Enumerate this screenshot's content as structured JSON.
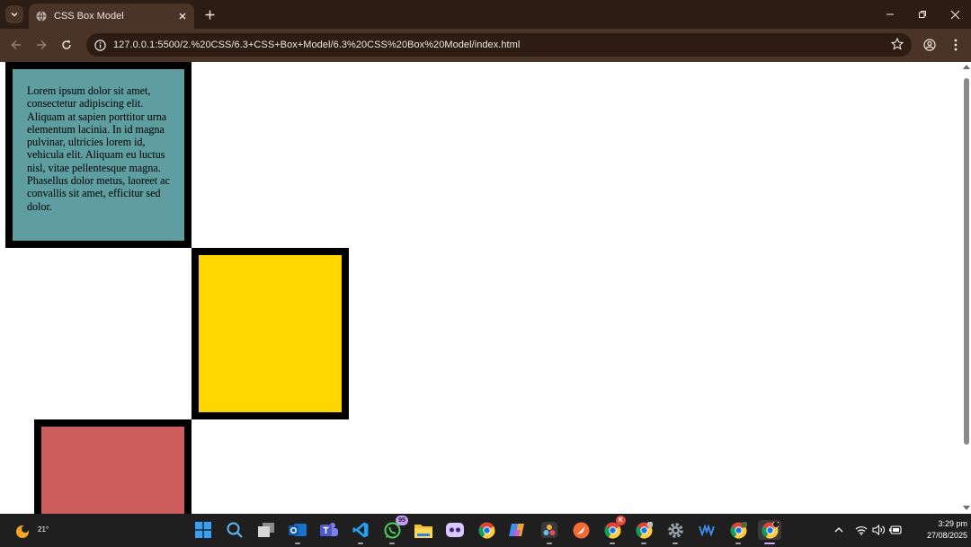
{
  "browser": {
    "tab_title": "CSS Box Model",
    "url": "127.0.0.1:5500/2.%20CSS/6.3+CSS+Box+Model/6.3%20CSS%20Box%20Model/index.html"
  },
  "page": {
    "paragraph": "Lorem ipsum dolor sit amet, consectetur adipiscing elit. Aliquam at sapien porttitor urna elementum lacinia. In id magna pulvinar, ultricies lorem id, vehicula elit. Aliquam eu luctus nisl, vitae pellentesque magna. Phasellus dolor metus, laoreet ac convallis sit amet, efficitur sed dolor.",
    "colors": {
      "text_box": "#5f9ea0",
      "gold_box": "#ffd700",
      "red_box": "#cd5c5c",
      "border": "#000000"
    }
  },
  "taskbar": {
    "weather_temp": "21°",
    "apps": [
      "start",
      "search",
      "task-view",
      "outlook",
      "teams",
      "vscode",
      "whatsapp",
      "file-explorer",
      "discord",
      "chrome",
      "copilot",
      "davinci-resolve",
      "postman",
      "chrome-profile-k",
      "chrome-profile-2",
      "settings",
      "wave-app",
      "chrome-profile-3",
      "chrome-active"
    ],
    "whatsapp_badge": "95",
    "chrome_k_badge": "K",
    "time": "3:29 pm",
    "date": "27/08/2025"
  }
}
